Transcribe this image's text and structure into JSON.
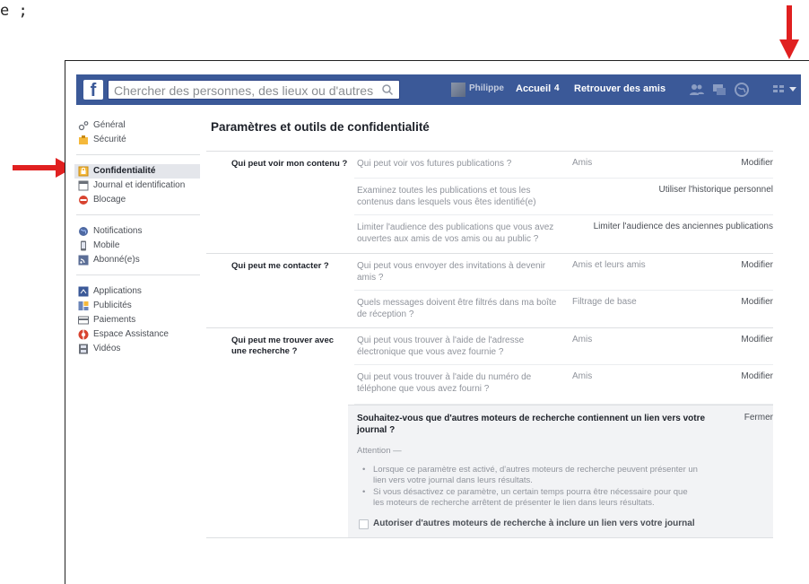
{
  "corner_text": "e ;",
  "topbar": {
    "logo": "f",
    "search_placeholder": "Chercher des personnes, des lieux ou d'autres choses",
    "profile_name": "Philippe",
    "home_label": "Accueil",
    "home_count": "4",
    "find_friends_label": "Retrouver des amis"
  },
  "sidebar": {
    "groups": [
      [
        {
          "label": "Général",
          "icon": "gear-icon"
        },
        {
          "label": "Sécurité",
          "icon": "badge-icon"
        }
      ],
      [
        {
          "label": "Confidentialité",
          "icon": "lock-icon",
          "active": true
        },
        {
          "label": "Journal et identification",
          "icon": "timeline-icon"
        },
        {
          "label": "Blocage",
          "icon": "block-icon"
        }
      ],
      [
        {
          "label": "Notifications",
          "icon": "globe-icon"
        },
        {
          "label": "Mobile",
          "icon": "phone-icon"
        },
        {
          "label": "Abonné(e)s",
          "icon": "rss-icon"
        }
      ],
      [
        {
          "label": "Applications",
          "icon": "apps-icon"
        },
        {
          "label": "Publicités",
          "icon": "ads-icon"
        },
        {
          "label": "Paiements",
          "icon": "card-icon"
        },
        {
          "label": "Espace Assistance",
          "icon": "help-icon"
        },
        {
          "label": "Vidéos",
          "icon": "film-icon"
        }
      ]
    ]
  },
  "main": {
    "title": "Paramètres et outils de confidentialité",
    "sections": [
      {
        "label": "Qui peut voir mon contenu ?",
        "rows": [
          {
            "question": "Qui peut voir vos futures publications ?",
            "value": "Amis",
            "action": "Modifier"
          },
          {
            "question": "Examinez toutes les publications et tous les contenus dans lesquels vous êtes identifié(e)",
            "value": "",
            "action": "Utiliser l'historique personnel"
          },
          {
            "question": "Limiter l'audience des publications que vous avez ouvertes aux amis de vos amis ou au public ?",
            "value": "",
            "action": "Limiter l'audience des anciennes publications"
          }
        ]
      },
      {
        "label": "Qui peut me contacter ?",
        "rows": [
          {
            "question": "Qui peut vous envoyer des invitations à devenir amis ?",
            "value": "Amis et leurs amis",
            "action": "Modifier"
          },
          {
            "question": "Quels messages doivent être filtrés dans ma boîte de réception ?",
            "value": "Filtrage de base",
            "action": "Modifier"
          }
        ]
      },
      {
        "label": "Qui peut me trouver avec une recherche ?",
        "rows": [
          {
            "question": "Qui peut vous trouver à l'aide de l'adresse électronique que vous avez fournie ?",
            "value": "Amis",
            "action": "Modifier"
          },
          {
            "question": "Qui peut vous trouver à l'aide du numéro de téléphone que vous avez fourni ?",
            "value": "Amis",
            "action": "Modifier"
          }
        ],
        "expanded": {
          "title": "Souhaitez-vous que d'autres moteurs de recherche contiennent un lien vers votre journal ?",
          "close": "Fermer",
          "warning": "Attention —",
          "bullets": [
            "Lorsque ce paramètre est activé, d'autres moteurs de recherche peuvent présenter un lien vers votre journal dans leurs résultats.",
            "Si vous désactivez ce paramètre, un certain temps pourra être nécessaire pour que les moteurs de recherche arrêtent de présenter le lien dans leurs résultats."
          ],
          "checkbox_label": "Autoriser d'autres moteurs de recherche à inclure un lien vers votre journal",
          "checkbox_checked": false
        }
      }
    ]
  },
  "colors": {
    "brand": "#3b5998",
    "annotation_arrow": "#e02020"
  }
}
